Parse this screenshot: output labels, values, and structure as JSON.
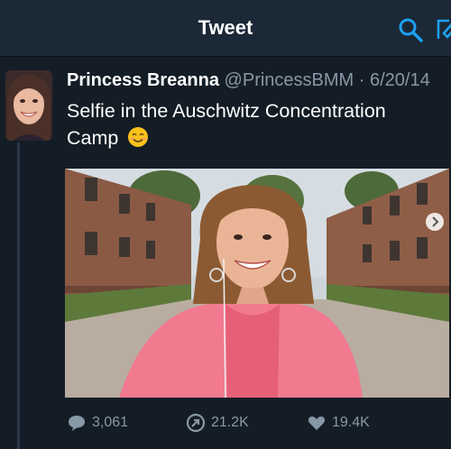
{
  "header": {
    "title": "Tweet"
  },
  "tweet": {
    "author_name": "Princess Breanna",
    "handle": "@PrincessBMM",
    "separator": "·",
    "date": "6/20/14",
    "text": "Selfie in the Auschwitz Concentration Camp",
    "emoji": "😊"
  },
  "actions": {
    "replies": "3,061",
    "retweets": "21.2K",
    "likes": "19.4K"
  },
  "colors": {
    "background": "#141d26",
    "header": "#1b2836",
    "accent": "#1da1f2",
    "muted": "#8899a6"
  },
  "icons": [
    "search-icon",
    "compose-icon",
    "reply-icon",
    "retweet-icon",
    "heart-icon",
    "chevron-right-icon"
  ]
}
